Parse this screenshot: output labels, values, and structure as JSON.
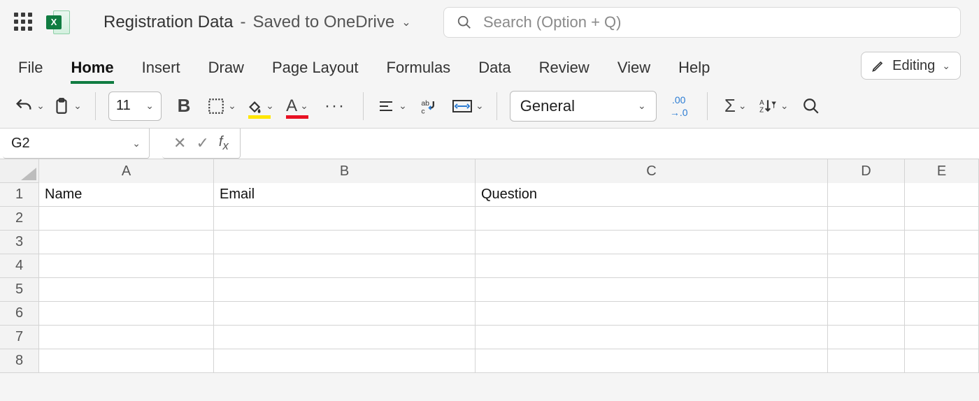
{
  "title": {
    "document_name": "Registration Data",
    "save_status": "Saved to OneDrive"
  },
  "search": {
    "placeholder": "Search (Option + Q)"
  },
  "ribbon": {
    "tabs": [
      "File",
      "Home",
      "Insert",
      "Draw",
      "Page Layout",
      "Formulas",
      "Data",
      "Review",
      "View",
      "Help"
    ],
    "active_tab": "Home",
    "mode_label": "Editing"
  },
  "toolbar": {
    "font_size": "11",
    "number_format": "General"
  },
  "formula_bar": {
    "name_box": "G2",
    "formula": ""
  },
  "sheet": {
    "columns": [
      "A",
      "B",
      "C",
      "D",
      "E"
    ],
    "rows": [
      "1",
      "2",
      "3",
      "4",
      "5",
      "6",
      "7",
      "8"
    ],
    "cells": {
      "A1": "Name",
      "B1": "Email",
      "C1": "Question"
    }
  }
}
